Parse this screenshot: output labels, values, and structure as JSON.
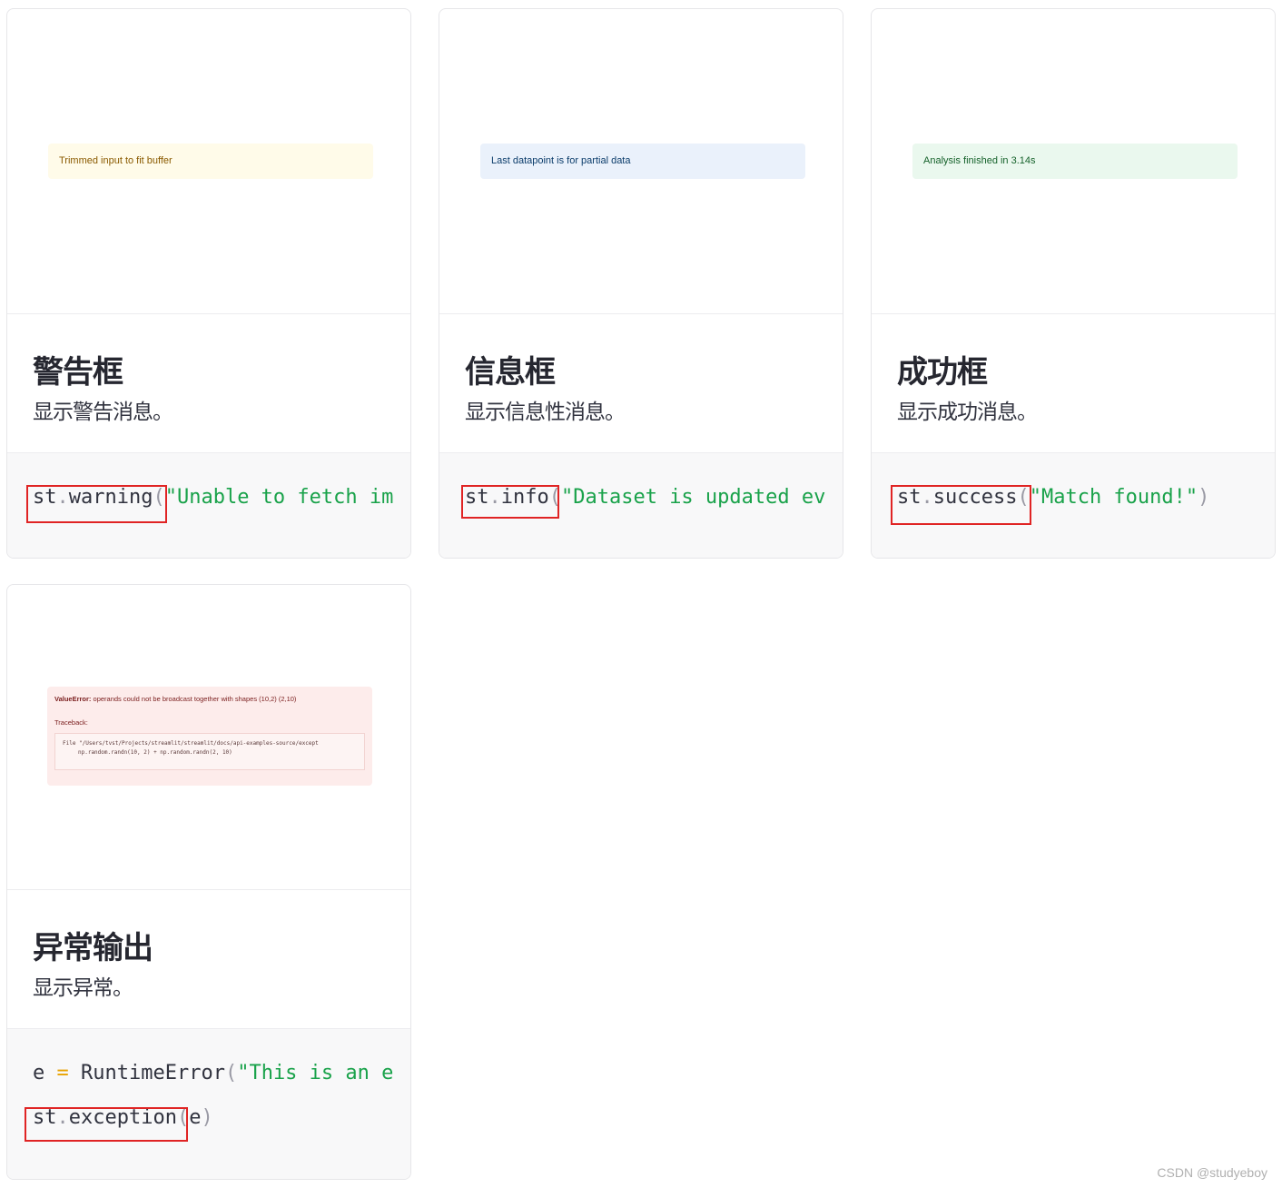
{
  "cards": {
    "warning": {
      "preview_text": "Trimmed input to fit buffer",
      "title": "警告框",
      "description": "显示警告消息。",
      "code": {
        "obj": "st",
        "dot": ".",
        "method": "warning",
        "open": "(",
        "arg": "\"Unable to fetch im"
      }
    },
    "info": {
      "preview_text": "Last datapoint is for partial data",
      "title": "信息框",
      "description": "显示信息性消息。",
      "code": {
        "obj": "st",
        "dot": ".",
        "method": "info",
        "open": "(",
        "arg": "\"Dataset is updated ev"
      }
    },
    "success": {
      "preview_text": "Analysis finished in 3.14s",
      "title": "成功框",
      "description": "显示成功消息。",
      "code": {
        "obj": "st",
        "dot": ".",
        "method": "success",
        "open": "(",
        "arg": "\"Match found!\"",
        "close": ")"
      }
    },
    "exception": {
      "preview": {
        "error_type": "ValueError:",
        "error_message": "operands could not be broadcast together with shapes (10,2) (2,10)",
        "traceback_label": "Traceback:",
        "trace_line1": "File \"/Users/tvst/Projects/streamlit/streamlit/docs/api-examples-source/except",
        "trace_line2": "np.random.randn(10, 2) + np.random.randn(2, 10)"
      },
      "title": "异常输出",
      "description": "显示异常。",
      "code_line1": {
        "var": "e",
        "op": "=",
        "cls": "RuntimeError",
        "open": "(",
        "arg": "\"This is an e"
      },
      "code_line2": {
        "obj": "st",
        "dot": ".",
        "method": "exception",
        "open": "(",
        "arg": "e",
        "close": ")"
      }
    }
  },
  "watermark": "CSDN @studyeboy",
  "colors": {
    "highlight_box": "#e02424",
    "string_token": "#19a24a",
    "warning_bg": "#fffbe9",
    "info_bg": "#eaf1fb",
    "success_bg": "#eaf8ee",
    "error_bg": "#fdeceb"
  }
}
